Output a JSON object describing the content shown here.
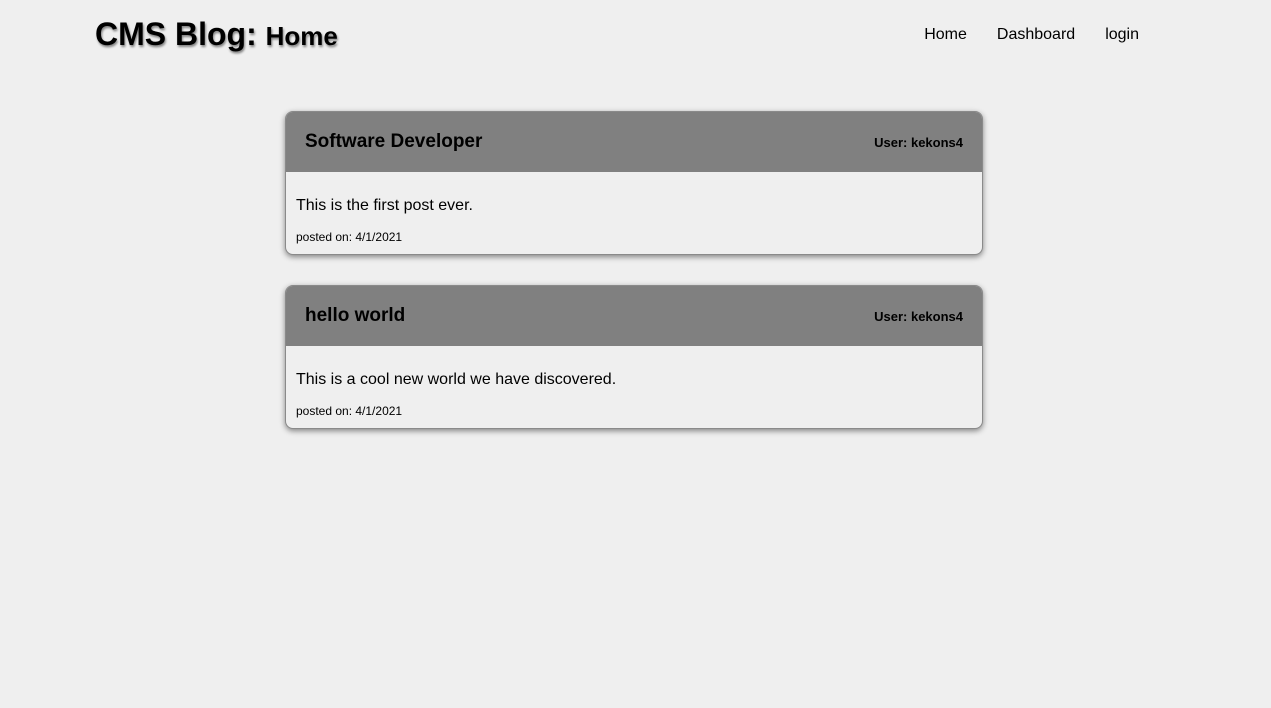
{
  "header": {
    "title": "CMS Blog:",
    "subtitle": "Home"
  },
  "nav": {
    "items": [
      {
        "label": "Home"
      },
      {
        "label": "Dashboard"
      },
      {
        "label": "login"
      }
    ]
  },
  "posts": [
    {
      "title": "Software Developer",
      "user": "User: kekons4",
      "content": "This is the first post ever.",
      "date": "posted on: 4/1/2021"
    },
    {
      "title": "hello world",
      "user": "User: kekons4",
      "content": "This is a cool new world we have discovered.",
      "date": "posted on: 4/1/2021"
    }
  ],
  "colors": {
    "background": "#efefef",
    "post_header": "#808080"
  }
}
